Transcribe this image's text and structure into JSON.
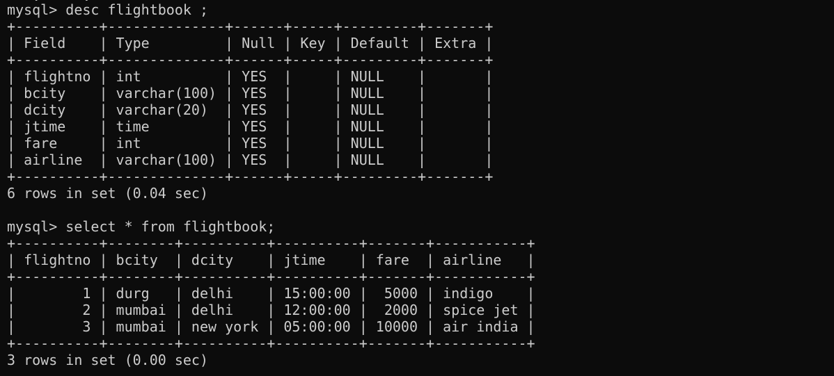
{
  "terminal": {
    "lines": [
      "mysql> desc flightbook ;",
      "+----------+--------------+------+-----+---------+-------+",
      "| Field    | Type         | Null | Key | Default | Extra |",
      "+----------+--------------+------+-----+---------+-------+",
      "| flightno | int          | YES  |     | NULL    |       |",
      "| bcity    | varchar(100) | YES  |     | NULL    |       |",
      "| dcity    | varchar(20)  | YES  |     | NULL    |       |",
      "| jtime    | time         | YES  |     | NULL    |       |",
      "| fare     | int          | YES  |     | NULL    |       |",
      "| airline  | varchar(100) | YES  |     | NULL    |       |",
      "+----------+--------------+------+-----+---------+-------+",
      "6 rows in set (0.04 sec)",
      "",
      "mysql> select * from flightbook;",
      "+----------+--------+----------+----------+-------+-----------+",
      "| flightno | bcity  | dcity    | jtime    | fare  | airline   |",
      "+----------+--------+----------+----------+-------+-----------+",
      "|        1 | durg   | delhi    | 15:00:00 |  5000 | indigo    |",
      "|        2 | mumbai | delhi    | 12:00:00 |  2000 | spice jet |",
      "|        3 | mumbai | new york | 05:00:00 | 10000 | air india |",
      "+----------+--------+----------+----------+-------+-----------+",
      "3 rows in set (0.00 sec)"
    ]
  }
}
